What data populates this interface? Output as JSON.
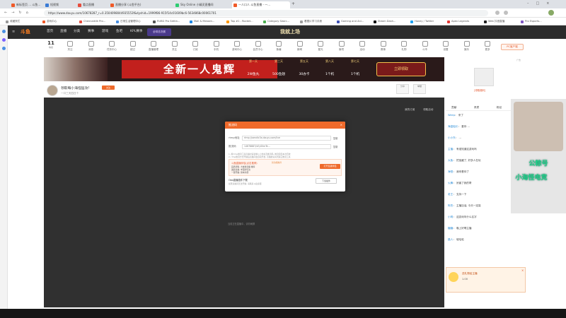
{
  "browser": {
    "tabs": [
      {
        "title": "新标签页 ... 斗鱼..."
      },
      {
        "title": "短视频"
      },
      {
        "title": "看点直播"
      },
      {
        "title": "直播分享 (斗鱼平台)"
      },
      {
        "title": "Sky Online 小精灵直播间"
      },
      {
        "title": "一人口人 斗鱼直播 - 一..."
      }
    ],
    "url": "https://www.douyu.com/10678287_r=0.3504098044935553f&dyshid=1999f86-915f14c01609bc6-5634868c00061701",
    "bookmarks": [
      "收藏夹栏",
      "游戏中心",
      "Chennaiklik Pro...",
      "日常生活管理中心",
      "RUBG Pro Settin...",
      "Mail & Messen...",
      "Top #1 - Rocket...",
      "Category Searc...",
      "看图片学习手册",
      "Gaming and Ani...",
      "Steam Dash...",
      "Honey / Twitter",
      "Apex Legends",
      "Web 抖音直播",
      "Pro Esports..."
    ]
  },
  "douyu": {
    "logo": "斗鱼",
    "nav": [
      "首页",
      "直播",
      "分类",
      "赛事",
      "游戏",
      "鱼吧",
      "KPL赛季"
    ],
    "nav_promo": "全球总决赛",
    "icons": [
      "关注",
      "消息",
      "任务中心",
      "超过",
      "直播管理",
      "关注",
      "订阅",
      "手机",
      "游戏中心",
      "会员中心",
      "鱼塘",
      "新闻",
      "星光",
      "鱼吧",
      "活动",
      "赛事",
      "礼物",
      "斗币",
      "设置",
      "娱乐",
      "更多"
    ],
    "banner_heading": "全新一人鬼辉",
    "banner_days": [
      "第一天",
      "第三天",
      "第五天",
      "第八天",
      "第七天"
    ],
    "banner_rewards": [
      "2W鱼丸",
      "500鱼翅",
      "30办卡",
      "1个机",
      "1个机"
    ],
    "room_title": "领取每小海怪猛攻!",
    "room_sub": "一口三天四日个",
    "right_ad_label": "广告",
    "right_ad_name": "[领取福利]",
    "stream_actions": [
      "我的订阅",
      "领取活动"
    ]
  },
  "modal": {
    "title": "推流码",
    "fields": [
      {
        "label": "rtmp地址",
        "value": "rtmp://sendtc3a.douyu.com/live",
        "action": "复制"
      },
      {
        "label": "推流码",
        "value": "14678887/vEyS0mTe...",
        "action": "复制"
      }
    ],
    "notes": [
      "1. 用rtmp推流工具直播时请复制以上地址及推流码, 推流码仅本次有效",
      "2. rtmp推流方式开播后直播间会自动开启, 直播前请关闭其它推流工具"
    ],
    "promo_title": "斗鱼直播伴侣(点击推荐)",
    "promo_badge": "新功能推荐",
    "promo_button": "打开直播伴侣",
    "promo_lines": [
      "画质清晰, 大放送直播 推荐",
      "美颜直播, 丰富的玩法",
      "一键开播, 简单方便"
    ],
    "bottom_text": "Obs直播插件下载",
    "bottom_button": "下载插件",
    "bottom_hint": "如果直播间无法开播, 请联系斗鱼客服"
  },
  "right_panel": {
    "tabs": [
      "贡献",
      "贵宾",
      "粉丝"
    ],
    "chat": [
      {
        "user": "Weep",
        "text": "来了"
      },
      {
        "user": "海盗船长",
        "text": "爱你 ..."
      },
      {
        "user": "小小东",
        "text": "..."
      },
      {
        "user": "主播",
        "text": "有谁知道这游戏吗"
      },
      {
        "user": "大鱼",
        "text": "挖宝藏了, 好多人在玩"
      },
      {
        "user": "海怪",
        "text": "我来看你了"
      },
      {
        "user": "火舞",
        "text": "厉害了我的哥"
      },
      {
        "user": "老王",
        "text": "支持一下"
      },
      {
        "user": "阿杰",
        "text": "主播加油, 今天一定赢"
      },
      {
        "user": "小明",
        "text": "这游戏叫什么名字"
      },
      {
        "user": "糖糖",
        "text": "晚上好啊主播"
      },
      {
        "user": "路人",
        "text": "哈哈哈"
      }
    ],
    "gift_title": "送礼物给主播",
    "gift_value": "1.00"
  },
  "webcam": {
    "label_line1": "公粽号",
    "label_line2": "小海怪电竞"
  },
  "colors": {
    "accent": "#ef6a2b",
    "nav_bg": "#2c2c2c",
    "stream_bg": "#303030"
  }
}
